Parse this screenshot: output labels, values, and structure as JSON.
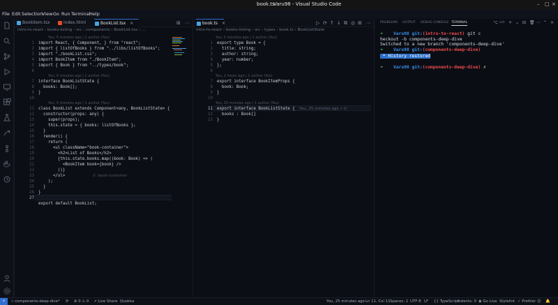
{
  "window": {
    "title": "book.ts",
    "app_title": "Varu98 - Visual Studio Code"
  },
  "menu": [
    "File",
    "Edit",
    "Selection",
    "View",
    "Go",
    "Run",
    "Terminal",
    "Help"
  ],
  "left_group": {
    "tabs": [
      {
        "label": "BookItem.tsx",
        "color": "#4aa3df"
      },
      {
        "label": "index.html",
        "color": "#e44d26"
      },
      {
        "label": "BookList.tsx",
        "color": "#4aa3df",
        "close": "×"
      }
    ],
    "breadcrumb": "intro-to-react › books-listing › src › components › BookList.tsx › ...",
    "lens": [
      "You, 5 minutes ago | 1 author (You)",
      "You, 5 minutes ago | 1 author (You)",
      "You, 5 minutes ago | 1 author (You)"
    ],
    "line_numbers": [
      "1",
      "2",
      "3",
      "4",
      "5",
      "6",
      "7",
      "8",
      "9",
      "10",
      "11",
      "12",
      "13",
      "14",
      "15",
      "16",
      "17",
      "18",
      "19",
      "20",
      "21",
      "22",
      "23",
      "24",
      "25",
      "26",
      "27"
    ],
    "line_1": "import React, { Component, } from \"react\";",
    "line_2": "import { listOfBooks } from \"../libs/listOfBooks\";",
    "line_3": "import \"./bookList.css\";",
    "line_4": "import BookItem from \"./BookItem\";",
    "line_5": "import { Book } from \"../types/book\";",
    "line_7": "interface BookListState {",
    "line_8": "  books: Book[];",
    "line_9": "}",
    "line_11": "class BookList extends Component<any, BookListState> {",
    "line_12": "  constructor(props: any) {",
    "line_13": "    super(props);",
    "line_14": "    this.state = { books: listOfBooks };",
    "line_15": "  }",
    "line_16": "  render() {",
    "line_17": "    return (",
    "line_18": "      <ul className=\"book-container\">",
    "line_19": "        <h2>List of Books</h2>",
    "line_20": "        {this.state.books.map((book: Book) => (",
    "line_21": "          <BookItem book={book} />",
    "line_22": "        ))}",
    "line_23": "      </ul>",
    "line_23_hint": "// .book-container",
    "line_24": "    );",
    "line_25": "  }",
    "line_26": "}",
    "line_28": "export default BookList;"
  },
  "right_group": {
    "tabs": [
      {
        "label": "book.ts",
        "color": "#4aa3df",
        "close": "×"
      }
    ],
    "breadcrumb": "intro-to-react › books-listing › src › types › book.ts › BookListState",
    "lens": [
      "You, 5 minutes ago | 1 author (You)",
      "You, 2 hours ago | 1 author (You)",
      "You, 25 minutes ago | 1 author (You)"
    ],
    "line_numbers": [
      "1",
      "2",
      "3",
      "4",
      "5",
      "6",
      "7",
      "8",
      "9",
      "10",
      "11",
      "12",
      "13"
    ],
    "line_1": "export type Book = {",
    "line_2": "  title: string;",
    "line_3": "  author: string;",
    "line_4": "  year: number;",
    "line_5": "};",
    "line_7": "export interface BookItemProps {",
    "line_8": "  book: Book;",
    "line_9": "}",
    "line_11": "export interface BookListState {",
    "line_11_blame": "You, 25 minutes ago • U",
    "line_12": "  books : Book[]",
    "line_13": "}"
  },
  "panel": {
    "tabs": [
      "PROBLEMS",
      "OUTPUT",
      "DEBUG CONSOLE",
      "TERMINAL"
    ],
    "active_tab": "TERMINAL",
    "shell_label": "zsh",
    "terminal": {
      "prompt_arrow": "➜",
      "user": "Varu98",
      "git_label": "git:",
      "branch_1": "(intro-to-react)",
      "cmd_1": " git c",
      "cmd_1b": "heckout -b components-deep-dive",
      "output_1": "Switched to a new branch 'components-deep-dive'",
      "branch_2": "(components-deep-dive)",
      "history": "History restored",
      "branch_3": "(components-deep-dive)",
      "dirty": " ✗"
    }
  },
  "statusbar": {
    "remote": "⚡",
    "branch": "components-deep-dive*",
    "sync": "⟳",
    "problems": "⊗ 0 ⚠ 0",
    "live_share": "Live Share",
    "quokka": "Quokka",
    "blame": "You, 25 minutes ago",
    "position": "Ln 11, Col 11",
    "spaces": "Spaces: 2",
    "encoding": "UTF-8",
    "eol": "LF",
    "language": "{} TypeScript",
    "indents": "Indents: 0",
    "go_live": "Go Live",
    "stylelint": "Stylelint",
    "prettier": "✓ Prettier"
  },
  "colors": {
    "accent": "#2f6fd1",
    "terminal_green": "#6bc46d",
    "terminal_blue": "#3b8eea",
    "terminal_red": "#f14c4c"
  }
}
